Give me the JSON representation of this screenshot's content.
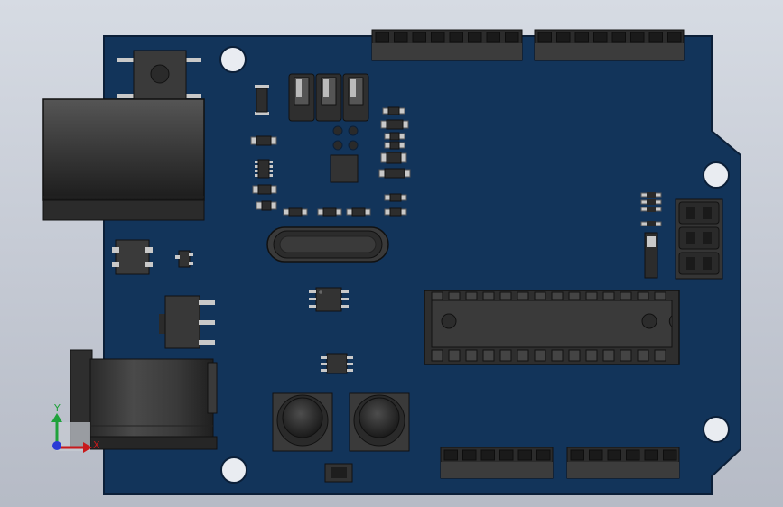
{
  "viewport": {
    "background_top": "#d6dbe3",
    "background_bottom": "#b6bbc6"
  },
  "board": {
    "color": "#12345a",
    "edge_color": "#0b1f38",
    "component_color": "#3a3a3a",
    "component_dark": "#1e1e1e",
    "pin_color": "#c9c9c9"
  },
  "components": {
    "usb_connector": "usb-b-connector",
    "power_jack": "dc-barrel-jack",
    "microcontroller": "dip-28-microcontroller",
    "crystal": "crystal-oscillator",
    "reset_switch": "tactile-switch",
    "push_buttons": [
      "push-button-left",
      "push-button-right"
    ],
    "header_count_top": 2,
    "header_count_bottom": 2,
    "icsp_header": "icsp-2x3-header"
  },
  "triad": {
    "y_label": "Y",
    "x_label": "X",
    "y_color": "#1fa23b",
    "x_color": "#c8191b",
    "origin_color": "#2b3bd6"
  }
}
